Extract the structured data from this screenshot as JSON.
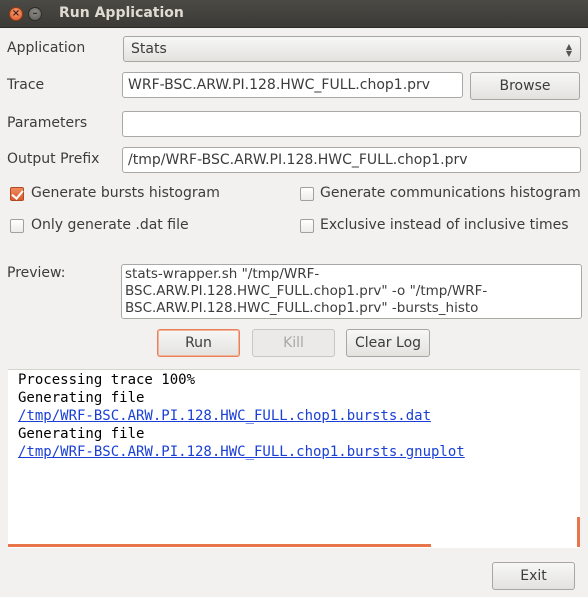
{
  "window": {
    "title": "Run Application",
    "close_glyph": "×",
    "minimize_glyph": "–"
  },
  "form": {
    "application_label": "Application",
    "application_value": "Stats",
    "trace_label": "Trace",
    "trace_value": "WRF-BSC.ARW.PI.128.HWC_FULL.chop1.prv",
    "browse_label": "Browse",
    "parameters_label": "Parameters",
    "parameters_value": "",
    "output_prefix_label": "Output Prefix",
    "output_prefix_value": "/tmp/WRF-BSC.ARW.PI.128.HWC_FULL.chop1.prv"
  },
  "options": {
    "bursts_histogram": {
      "label": "Generate bursts histogram",
      "checked": true
    },
    "communications_histogram": {
      "label": "Generate communications histogram",
      "checked": false
    },
    "only_dat": {
      "label": "Only generate .dat file",
      "checked": false
    },
    "exclusive_times": {
      "label": "Exclusive instead of inclusive times",
      "checked": false
    }
  },
  "preview": {
    "label": "Preview:",
    "text": "stats-wrapper.sh \"/tmp/WRF-BSC.ARW.PI.128.HWC_FULL.chop1.prv\" -o \"/tmp/WRF-BSC.ARW.PI.128.HWC_FULL.chop1.prv\" -bursts_histo"
  },
  "actions": {
    "run_label": "Run",
    "kill_label": "Kill",
    "clear_log_label": "Clear Log",
    "exit_label": "Exit"
  },
  "log": {
    "lines": [
      {
        "text": "Processing trace 100%",
        "link": false
      },
      {
        "text": "Generating file",
        "link": false
      },
      {
        "text": "/tmp/WRF-BSC.ARW.PI.128.HWC_FULL.chop1.bursts.dat",
        "link": true
      },
      {
        "text": "Generating file",
        "link": false
      },
      {
        "text": "/tmp/WRF-BSC.ARW.PI.128.HWC_FULL.chop1.bursts.gnuplot",
        "link": true
      }
    ],
    "progress_fraction": 0.74
  },
  "colors": {
    "accent": "#e8764a",
    "link": "#1a3fd6",
    "titlebar": "#3b3a36"
  }
}
